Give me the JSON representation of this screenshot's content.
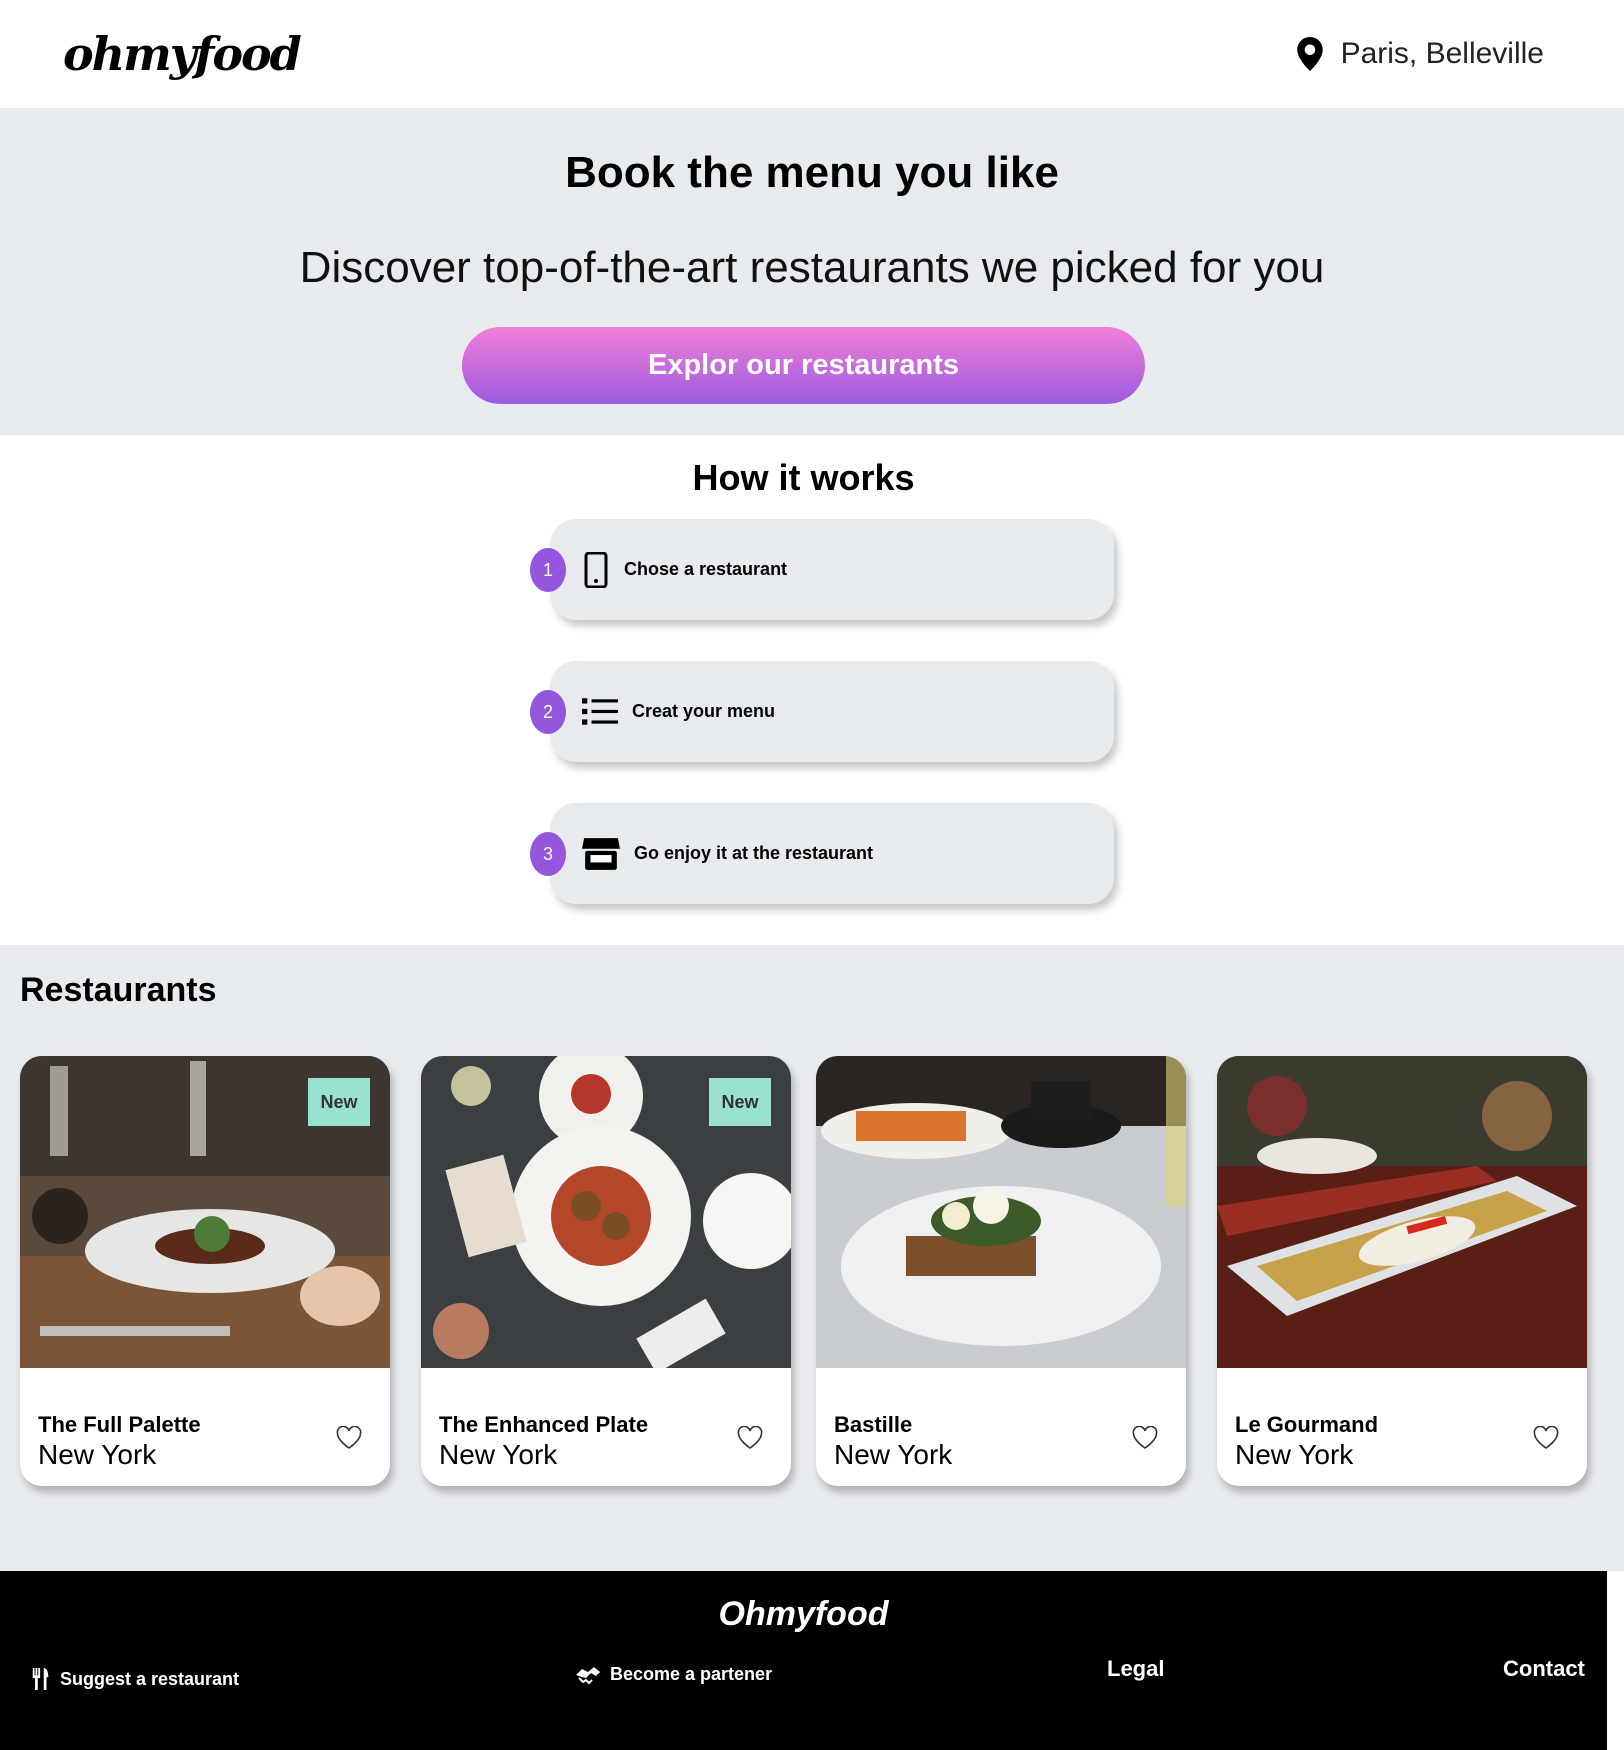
{
  "header": {
    "logo": "ohmyfood",
    "location": "Paris, Belleville"
  },
  "hero": {
    "title": "Book the menu you like",
    "subtitle": "Discover top-of-the-art restaurants we picked for you",
    "cta_label": "Explor our restaurants"
  },
  "how": {
    "title": "How it works",
    "steps": [
      {
        "number": "1",
        "label": "Chose a restaurant",
        "icon": "mobile-phone-icon"
      },
      {
        "number": "2",
        "label": "Creat your menu",
        "icon": "list-icon"
      },
      {
        "number": "3",
        "label": "Go enjoy it at the restaurant",
        "icon": "store-icon"
      }
    ]
  },
  "restaurants": {
    "title": "Restaurants",
    "items": [
      {
        "name": "The Full Palette",
        "city": "New York",
        "badge": "New"
      },
      {
        "name": "The Enhanced Plate",
        "city": "New York",
        "badge": "New"
      },
      {
        "name": "Bastille",
        "city": "New York",
        "badge": ""
      },
      {
        "name": "Le Gourmand",
        "city": "New York",
        "badge": ""
      }
    ]
  },
  "footer": {
    "brand": "Ohmyfood",
    "suggest": "Suggest a restaurant",
    "partner": "Become a partener",
    "legal": "Legal",
    "contact": "Contact"
  },
  "colors": {
    "accent_purple": "#9356dc",
    "cta_gradient_top": "#f47fd8",
    "cta_gradient_bottom": "#9a5ae0",
    "badge_green": "#99e2d0",
    "section_gray": "#e8ebee"
  }
}
